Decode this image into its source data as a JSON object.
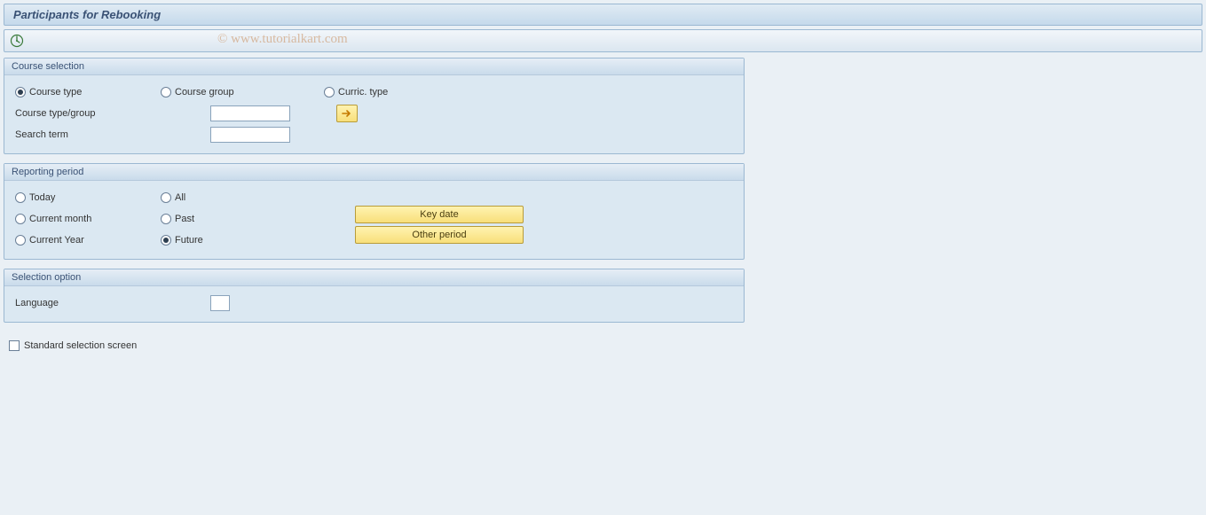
{
  "title": "Participants for Rebooking",
  "watermark": "© www.tutorialkart.com",
  "toolbar": {
    "execute_icon": "execute"
  },
  "groups": {
    "course_selection": {
      "title": "Course selection",
      "radios": {
        "course_type": "Course type",
        "course_group": "Course group",
        "curric_type": "Curric. type"
      },
      "fields": {
        "course_type_group": "Course type/group",
        "search_term": "Search term"
      },
      "values": {
        "course_type_group": "",
        "search_term": ""
      }
    },
    "reporting_period": {
      "title": "Reporting period",
      "radios": {
        "today": "Today",
        "current_month": "Current month",
        "current_year": "Current Year",
        "all": "All",
        "past": "Past",
        "future": "Future"
      },
      "buttons": {
        "key_date": "Key date",
        "other_period": "Other period"
      }
    },
    "selection_option": {
      "title": "Selection option",
      "fields": {
        "language": "Language"
      },
      "values": {
        "language": ""
      }
    }
  },
  "checkbox": {
    "standard_selection": "Standard selection screen"
  }
}
